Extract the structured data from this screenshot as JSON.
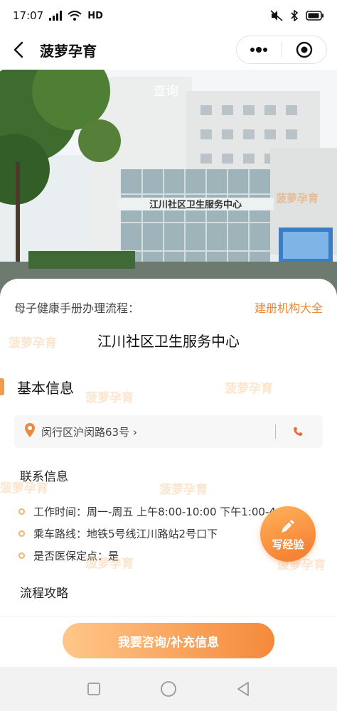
{
  "status_bar": {
    "time": "17:07",
    "network": "HD"
  },
  "nav": {
    "title": "菠萝孕育"
  },
  "hero": {
    "sign_text": "江川社区卫生服务中心",
    "overlay_text": "查询",
    "watermark": "菠萝孕育"
  },
  "card": {
    "process_label": "母子健康手册办理流程：",
    "org_link": "建册机构大全",
    "center_name": "江川社区卫生服务中心",
    "section_basic": "基本信息",
    "address": "闵行区沪闵路63号 ›",
    "contact_title": "联系信息",
    "info": [
      {
        "text": "工作时间：周一-周五 上午8:00-10:00 下午1:00-4:00"
      },
      {
        "text": "乘车路线：地铁5号线江川路站2号口下"
      },
      {
        "text": "是否医保定点：是"
      }
    ],
    "guide_title": "流程攻略"
  },
  "write_button": {
    "label": "写经验"
  },
  "bottom": {
    "consult_label": "我要咨询/补充信息"
  },
  "watermark_text": "菠萝孕育",
  "colors": {
    "accent": "#f0883a",
    "button_start": "#ffc78a",
    "button_end": "#f5893a",
    "section_bar": "#f39a4b"
  }
}
